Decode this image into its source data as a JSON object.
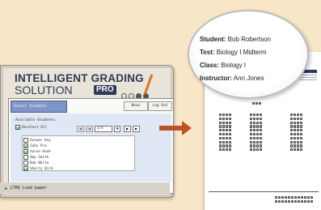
{
  "banner": {
    "line1": "INTELLIGENT GRADING",
    "line2": "SOLUTION",
    "badge": "PRO"
  },
  "topbar": {
    "select_tab": "Select Students",
    "news_label": "News",
    "logoff_label": "Log Out"
  },
  "students": {
    "heading": "Available Students:",
    "select_all": "Deselect All",
    "page_value": "1/4",
    "items": [
      {
        "label": "Answer Key",
        "checked": false
      },
      {
        "label": "John Pro",
        "checked": true
      },
      {
        "label": "Aaron Hank",
        "checked": true
      },
      {
        "label": "Amy Smith",
        "checked": false
      },
      {
        "label": "Bob White",
        "checked": false
      },
      {
        "label": "Sherry Bird",
        "checked": true
      }
    ]
  },
  "print_label": "Print",
  "status": {
    "text": "LTRQ Load paper"
  },
  "magnifier": {
    "student_label": "Student:",
    "student_value": "Bob Robertson",
    "test_label": "Test:",
    "test_value": "Biology I Midterm",
    "class_label": "Class:",
    "class_value": "Biology I",
    "instructor_label": "Instructor:",
    "instructor_value": "Ann Jones"
  },
  "colors": {
    "background": "#f8e6c8",
    "arrow": "#c0502a",
    "accent_tab": "#7f95c7",
    "brand_dark": "#2f3a56",
    "brand_orange": "#d7762a"
  }
}
